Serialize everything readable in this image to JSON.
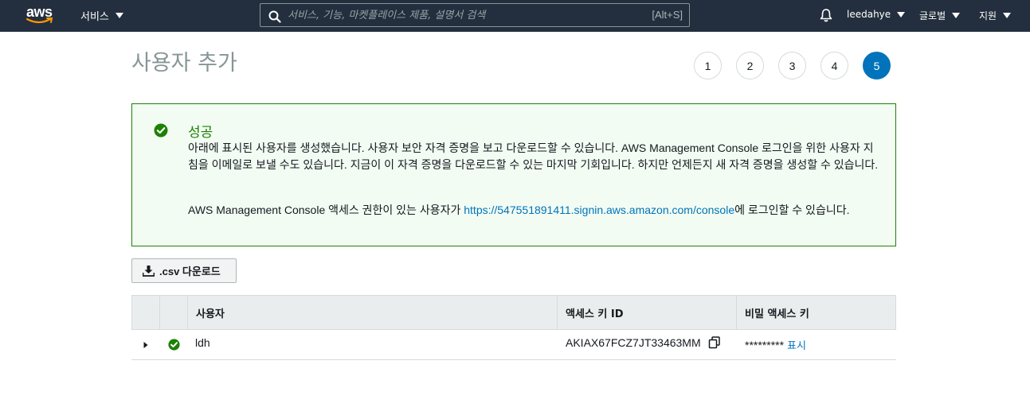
{
  "nav": {
    "logo_text": "aws",
    "services_label": "서비스",
    "search_placeholder": "서비스, 기능, 마켓플레이스 제품, 설명서 검색",
    "search_hint": "[Alt+S]",
    "user_label": "leedahye",
    "region_label": "글로벌",
    "support_label": "지원"
  },
  "page": {
    "title": "사용자 추가",
    "steps": [
      "1",
      "2",
      "3",
      "4",
      "5"
    ],
    "active_step": "5"
  },
  "success": {
    "heading": "성공",
    "description": "아래에 표시된 사용자를 생성했습니다. 사용자 보안 자격 증명을 보고 다운로드할 수 있습니다. AWS Management Console 로그인을 위한 사용자 지침을 이메일로 보낼 수도 있습니다. 지금이 이 자격 증명을 다운로드할 수 있는 마지막 기회입니다. 하지만 언제든지 새 자격 증명을 생성할 수 있습니다.",
    "console_prefix": "AWS Management Console 액세스 권한이 있는 사용자가 ",
    "console_url": "https://547551891411.signin.aws.amazon.com/console",
    "console_suffix": "에 로그인할 수 있습니다."
  },
  "csv_button_label": ".csv 다운로드",
  "table": {
    "columns": [
      "사용자",
      "액세스 키 ID",
      "비밀 액세스 키"
    ],
    "rows": [
      {
        "user": "ldh",
        "access_key_id": "AKIAX67FCZ7JT33463MM",
        "secret_masked": "*********",
        "show_label": "표시"
      }
    ]
  },
  "colors": {
    "nav_bg": "#232f3e",
    "success_green": "#1d8102",
    "link_blue": "#0073bb"
  }
}
